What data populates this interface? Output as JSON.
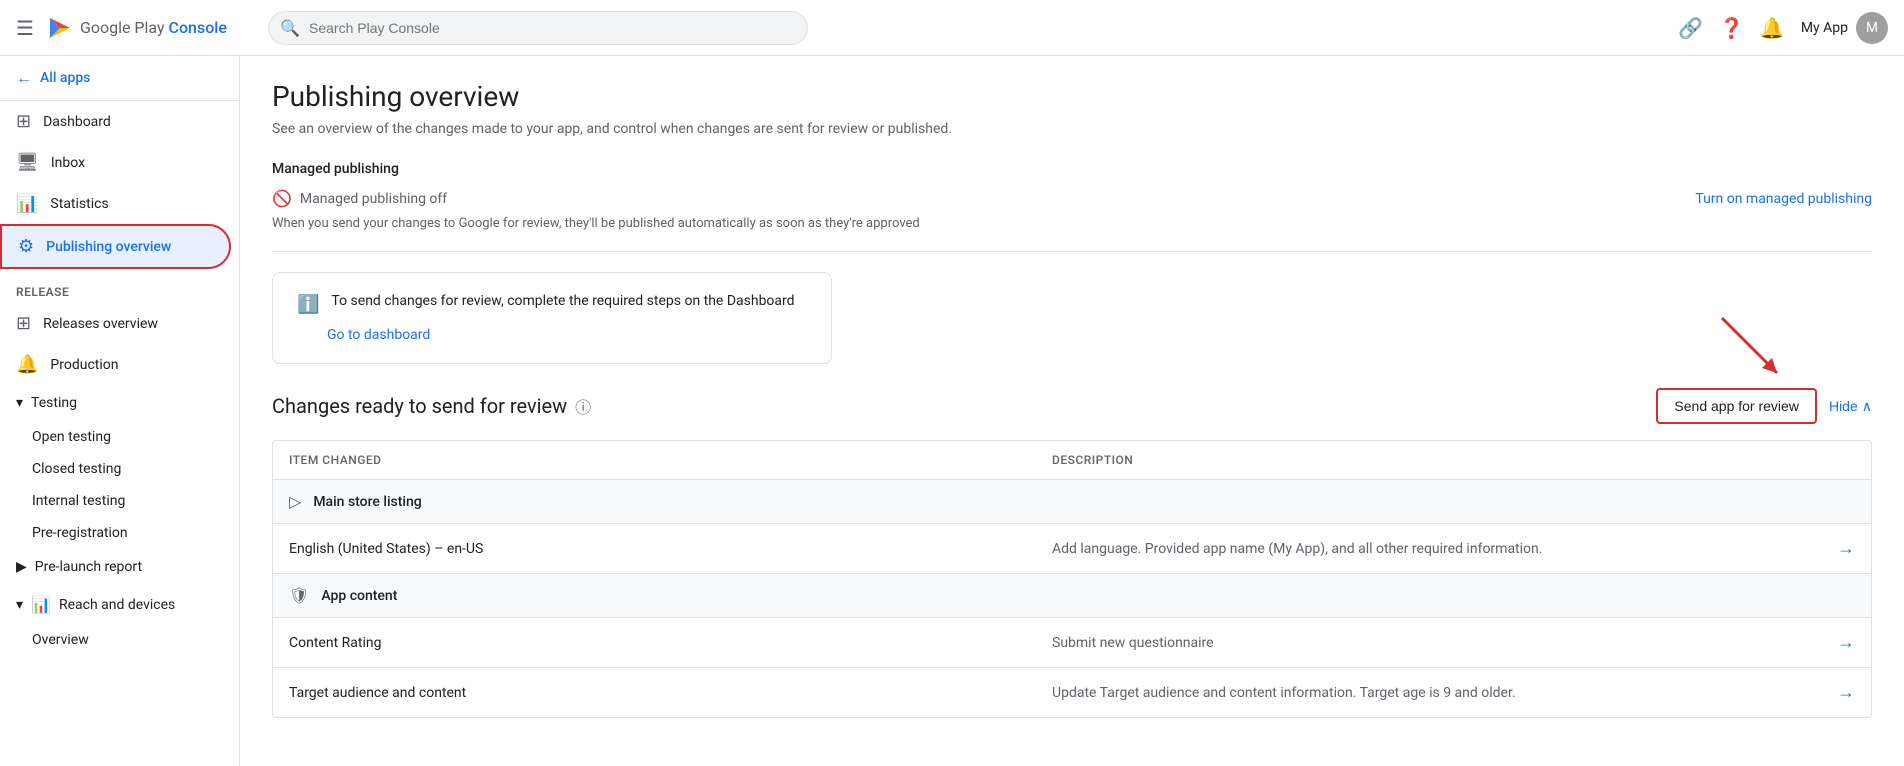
{
  "topbar": {
    "menu_icon": "☰",
    "logo_google": "Google Play ",
    "logo_console": "Console",
    "search_placeholder": "Search Play Console",
    "link_icon": "🔗",
    "help_icon": "?",
    "notifications_icon": "🔔",
    "user_name": "My App",
    "avatar_letter": "M"
  },
  "sidebar": {
    "all_apps_label": "All apps",
    "nav_items": [
      {
        "id": "dashboard",
        "label": "Dashboard",
        "icon": "⊞"
      },
      {
        "id": "inbox",
        "label": "Inbox",
        "icon": "🖥"
      },
      {
        "id": "statistics",
        "label": "Statistics",
        "icon": "📊"
      },
      {
        "id": "publishing",
        "label": "Publishing overview",
        "icon": "⚙",
        "active": true
      }
    ],
    "release_section": "Release",
    "release_items": [
      {
        "id": "releases-overview",
        "label": "Releases overview",
        "icon": "⊞"
      },
      {
        "id": "production",
        "label": "Production",
        "icon": "🔔"
      }
    ],
    "testing_item": {
      "label": "Testing",
      "icon": "⏱",
      "expandable": true
    },
    "testing_sub_items": [
      {
        "id": "open-testing",
        "label": "Open testing"
      },
      {
        "id": "closed-testing",
        "label": "Closed testing"
      },
      {
        "id": "internal-testing",
        "label": "Internal testing"
      },
      {
        "id": "pre-registration",
        "label": "Pre-registration"
      }
    ],
    "pre_launch_item": {
      "label": "Pre-launch report",
      "expandable": true
    },
    "reach_devices_item": {
      "label": "Reach and devices",
      "icon": "📊",
      "expandable": true
    },
    "overview_sub": {
      "label": "Overview"
    }
  },
  "main": {
    "page_title": "Publishing overview",
    "page_subtitle": "See an overview of the changes made to your app, and control when changes are sent for review or published.",
    "managed_pub_section": "Managed publishing",
    "managed_pub_status": "Managed publishing off",
    "managed_pub_desc": "When you send your changes to Google for review, they'll be published automatically as soon as they're approved",
    "turn_on_link": "Turn on managed publishing",
    "info_box_text": "To send changes for review, complete the required steps on the Dashboard",
    "go_dashboard_link": "Go to dashboard",
    "changes_title": "Changes ready to send for review",
    "send_review_btn": "Send app for review",
    "hide_btn": "Hide",
    "table_header_item": "Item changed",
    "table_header_desc": "Description",
    "table_groups": [
      {
        "id": "main-store-listing",
        "label": "Main store listing",
        "icon": "▷",
        "rows": [
          {
            "item": "English (United States) – en-US",
            "desc": "Add language. Provided app name (My App), and all other required information.",
            "has_arrow": true
          }
        ]
      },
      {
        "id": "app-content",
        "label": "App content",
        "icon": "🛡",
        "rows": [
          {
            "item": "Content Rating",
            "desc": "Submit new questionnaire",
            "has_arrow": true
          },
          {
            "item": "Target audience and content",
            "desc": "Update Target audience and content information. Target age is 9 and older.",
            "has_arrow": true
          }
        ]
      }
    ]
  }
}
